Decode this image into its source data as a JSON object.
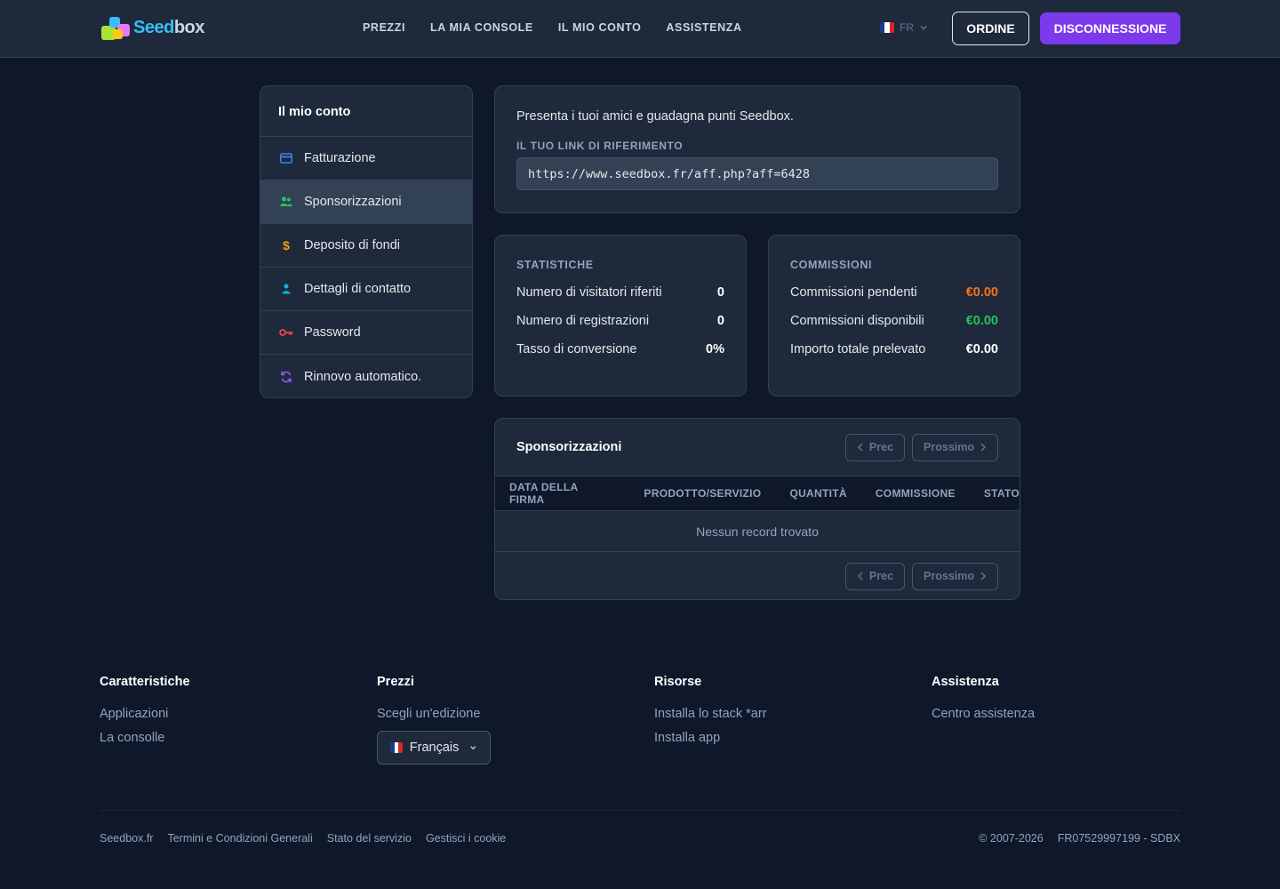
{
  "brand": {
    "name_part1": "Seed",
    "name_part2": "box"
  },
  "nav": [
    {
      "label": "PREZZI"
    },
    {
      "label": "LA MIA CONSOLE"
    },
    {
      "label": "IL MIO CONTO"
    },
    {
      "label": "ASSISTENZA"
    }
  ],
  "header": {
    "language": "FR",
    "order_label": "ORDINE",
    "logout_label": "DISCONNESSIONE"
  },
  "sidebar": {
    "title": "Il mio conto",
    "items": [
      {
        "label": "Fatturazione",
        "icon": "credit-card-icon"
      },
      {
        "label": "Sponsorizzazioni",
        "icon": "users-icon",
        "active": true
      },
      {
        "label": "Deposito di fondi",
        "icon": "dollar-icon"
      },
      {
        "label": "Dettagli di contatto",
        "icon": "user-icon"
      },
      {
        "label": "Password",
        "icon": "key-icon"
      },
      {
        "label": "Rinnovo automatico.",
        "icon": "refresh-icon"
      }
    ]
  },
  "referral": {
    "intro": "Presenta i tuoi amici e guadagna punti Seedbox.",
    "link_label": "IL TUO LINK DI RIFERIMENTO",
    "link_value": "https://www.seedbox.fr/aff.php?aff=6428"
  },
  "stats": {
    "title": "STATISTICHE",
    "rows": [
      {
        "label": "Numero di visitatori riferiti",
        "value": "0"
      },
      {
        "label": "Numero di registrazioni",
        "value": "0"
      },
      {
        "label": "Tasso di conversione",
        "value": "0%"
      }
    ]
  },
  "commissions": {
    "title": "COMMISSIONI",
    "rows": [
      {
        "label": "Commissioni pendenti",
        "value": "€0.00",
        "color": "#f97316"
      },
      {
        "label": "Commissioni disponibili",
        "value": "€0.00",
        "color": "#22c55e"
      },
      {
        "label": "Importo totale prelevato",
        "value": "€0.00",
        "color": "#ffffff"
      }
    ]
  },
  "sponsorships": {
    "title": "Sponsorizzazioni",
    "prev_label": "Prec",
    "next_label": "Prossimo",
    "columns": [
      "DATA DELLA FIRMA",
      "PRODOTTO/SERVIZIO",
      "QUANTITÀ",
      "COMMISSIONE",
      "STATO"
    ],
    "empty_text": "Nessun record trovato"
  },
  "footer": {
    "columns": [
      {
        "title": "Caratteristiche",
        "links": [
          "Applicazioni",
          "La consolle"
        ]
      },
      {
        "title": "Prezzi",
        "links": [
          "Scegli un'edizione"
        ]
      },
      {
        "title": "Risorse",
        "links": [
          "Installa lo stack *arr",
          "Installa app"
        ]
      },
      {
        "title": "Assistenza",
        "links": [
          "Centro assistenza"
        ]
      }
    ],
    "language_select": "Français",
    "legal_links": [
      "Seedbox.fr",
      "Termini e Condizioni Generali",
      "Stato del servizio",
      "Gestisci i cookie"
    ],
    "copyright": "© 2007-2026",
    "company_id": "FR07529997199 - SDBX"
  },
  "colors": {
    "background": "#0f172a",
    "panel": "#1e293b",
    "accent": "#7c3aed",
    "pending": "#f97316",
    "available": "#22c55e"
  }
}
